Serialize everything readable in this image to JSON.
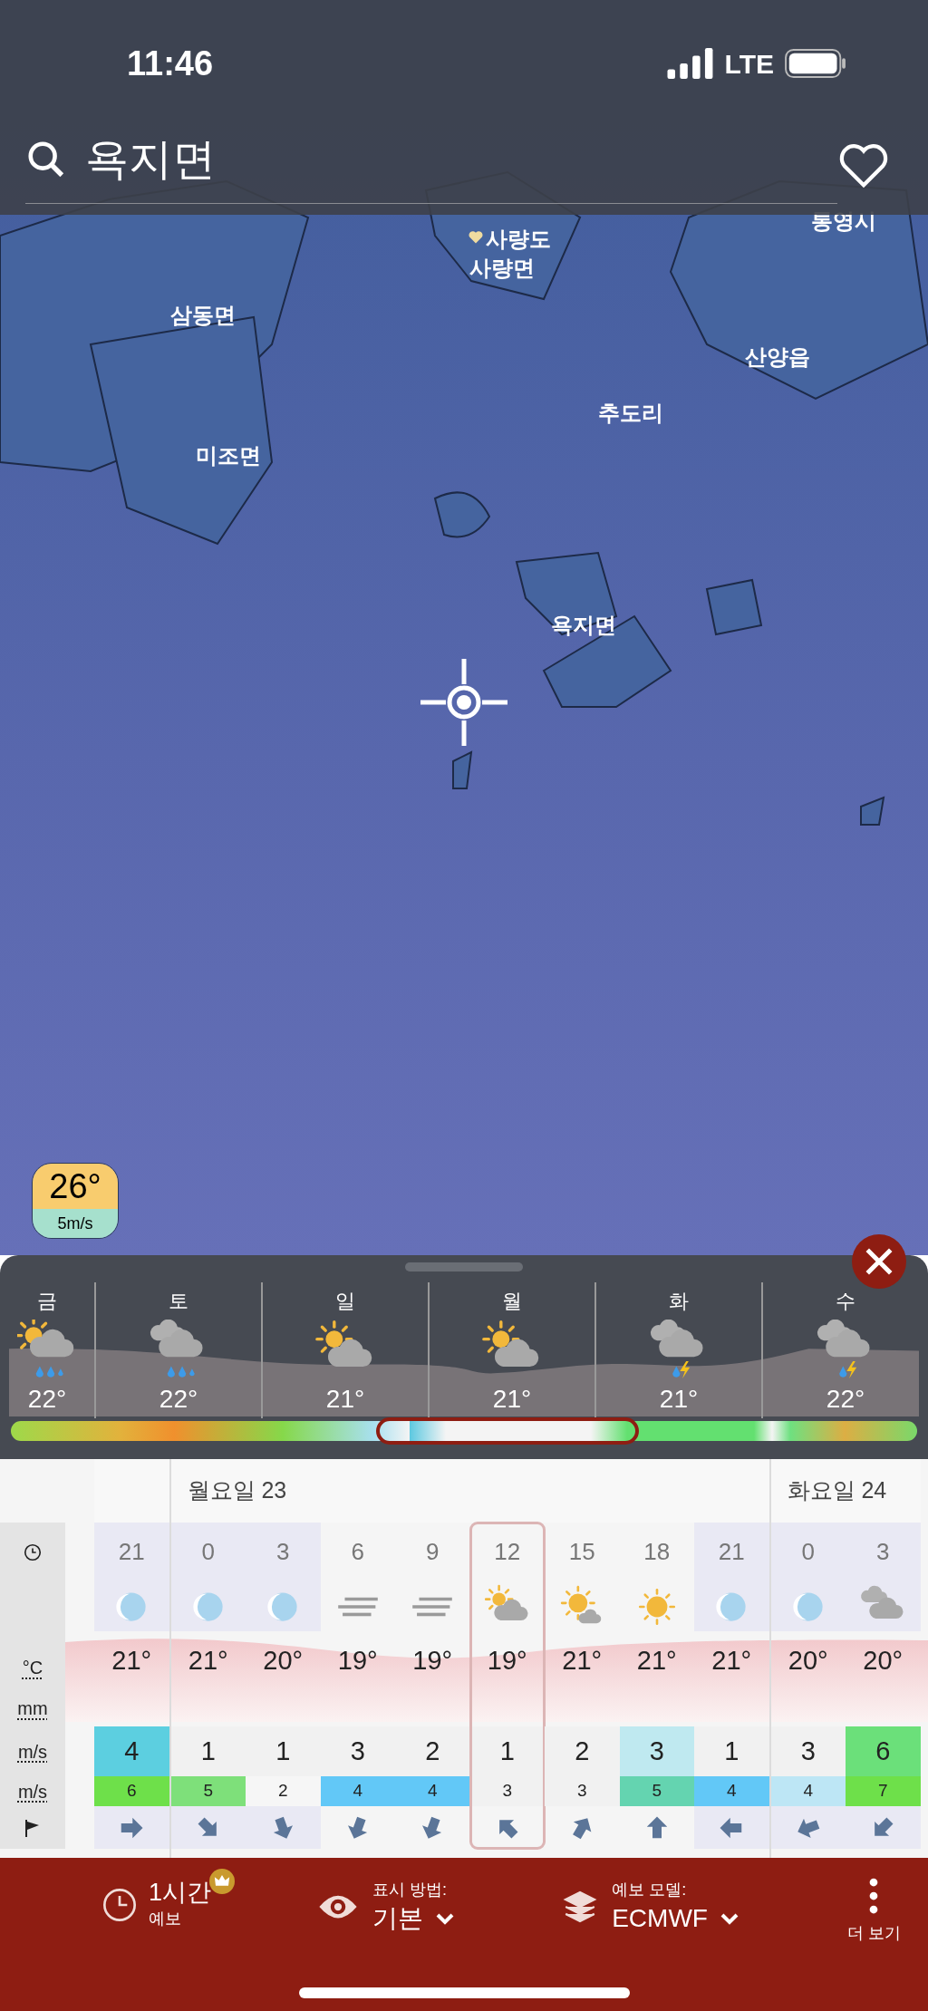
{
  "status_bar": {
    "time": "11:46",
    "network": "LTE"
  },
  "search": {
    "value": "욕지면",
    "favorite": false
  },
  "map": {
    "labels": [
      "사량도",
      "사량면",
      "통영시",
      "삼동면",
      "산양읍",
      "추도리",
      "미조면",
      "욕지면"
    ],
    "badge": {
      "temperature": "26°",
      "wind": "5m/s"
    }
  },
  "days": [
    {
      "label": "금",
      "kind": "sun-rain",
      "temp": "22°"
    },
    {
      "label": "토",
      "kind": "rain",
      "temp": "22°"
    },
    {
      "label": "일",
      "kind": "partly-cloudy",
      "temp": "21°"
    },
    {
      "label": "월",
      "kind": "partly-cloudy",
      "temp": "21°"
    },
    {
      "label": "화",
      "kind": "storm",
      "temp": "21°"
    },
    {
      "label": "수",
      "kind": "storm",
      "temp": "22°"
    }
  ],
  "table": {
    "row_labels": [
      {
        "kind": "time"
      },
      {
        "kind": "text",
        "text": "°C"
      },
      {
        "kind": "text",
        "text": "mm"
      },
      {
        "kind": "text",
        "text": "m/s"
      },
      {
        "kind": "text",
        "text": "m/s"
      },
      {
        "kind": "direction"
      }
    ],
    "groups": [
      {
        "hours": [
          {
            "hour": "21",
            "kind": "moon",
            "temp": "21°",
            "night": true,
            "selected": false,
            "wind": {
              "value": "4",
              "color": "#5ccfe0"
            },
            "gust": {
              "value": "6",
              "color": "#6ee04a"
            },
            "arrow": {
              "kind": "E"
            }
          }
        ]
      },
      {
        "label": "월요일 23",
        "hours": [
          {
            "hour": "0",
            "kind": "moon",
            "temp": "21°",
            "night": true,
            "selected": false,
            "wind": {
              "value": "1",
              "color": "#f1f1f1"
            },
            "gust": {
              "value": "5",
              "color": "#7ee07a"
            },
            "arrow": {
              "kind": "SE"
            }
          },
          {
            "hour": "3",
            "kind": "moon",
            "temp": "20°",
            "night": true,
            "selected": false,
            "wind": {
              "value": "1",
              "color": "#f1f1f1"
            },
            "gust": {
              "value": "2",
              "color": "#f6f6f6"
            },
            "arrow": {
              "kind": "SSE"
            }
          },
          {
            "hour": "6",
            "kind": "fog",
            "temp": "19°",
            "night": false,
            "selected": false,
            "wind": {
              "value": "3",
              "color": "#f1f1f1"
            },
            "gust": {
              "value": "4",
              "color": "#62c8f7"
            },
            "arrow": {
              "kind": "SSW"
            }
          },
          {
            "hour": "9",
            "kind": "fog",
            "temp": "19°",
            "night": false,
            "selected": false,
            "wind": {
              "value": "2",
              "color": "#f1f1f1"
            },
            "gust": {
              "value": "4",
              "color": "#62c8f7"
            },
            "arrow": {
              "kind": "SSW"
            }
          },
          {
            "hour": "12",
            "kind": "partly-cloudy",
            "temp": "19°",
            "night": false,
            "selected": true,
            "wind": {
              "value": "1",
              "color": "#f1f1f1"
            },
            "gust": {
              "value": "3",
              "color": "#f1f1f1"
            },
            "arrow": {
              "kind": "NW"
            }
          },
          {
            "hour": "15",
            "kind": "mostly-sunny",
            "temp": "21°",
            "night": false,
            "selected": false,
            "wind": {
              "value": "2",
              "color": "#f1f1f1"
            },
            "gust": {
              "value": "3",
              "color": "#f1f1f1"
            },
            "arrow": {
              "kind": "NNE"
            }
          },
          {
            "hour": "18",
            "kind": "sun",
            "temp": "21°",
            "night": false,
            "selected": false,
            "wind": {
              "value": "3",
              "color": "#bfe9f0"
            },
            "gust": {
              "value": "5",
              "color": "#64d4b0"
            },
            "arrow": {
              "kind": "N"
            }
          },
          {
            "hour": "21",
            "kind": "moon",
            "temp": "21°",
            "night": true,
            "selected": false,
            "wind": {
              "value": "1",
              "color": "#f1f1f1"
            },
            "gust": {
              "value": "4",
              "color": "#62c8f7"
            },
            "arrow": {
              "kind": "W"
            }
          }
        ]
      },
      {
        "label": "화요일 24",
        "hours": [
          {
            "hour": "0",
            "kind": "moon",
            "temp": "20°",
            "night": true,
            "selected": false,
            "wind": {
              "value": "3",
              "color": "#f1f1f1"
            },
            "gust": {
              "value": "4",
              "color": "#bde6f5"
            },
            "arrow": {
              "kind": "WSW"
            }
          },
          {
            "hour": "3",
            "kind": "cloudy",
            "temp": "20°",
            "night": true,
            "selected": false,
            "wind": {
              "value": "6",
              "color": "#6be07a"
            },
            "gust": {
              "value": "7",
              "color": "#6ee04a"
            },
            "arrow": {
              "kind": "SW"
            }
          }
        ]
      }
    ]
  },
  "toolbar": [
    {
      "kind": "interval",
      "title": "1시간",
      "subtitle": "예보"
    },
    {
      "kind": "select",
      "label": "표시 방법:",
      "value": "기본"
    },
    {
      "kind": "select",
      "label": "예보 모델:",
      "value": "ECMWF"
    },
    {
      "kind": "more",
      "label": "더 보기"
    }
  ]
}
